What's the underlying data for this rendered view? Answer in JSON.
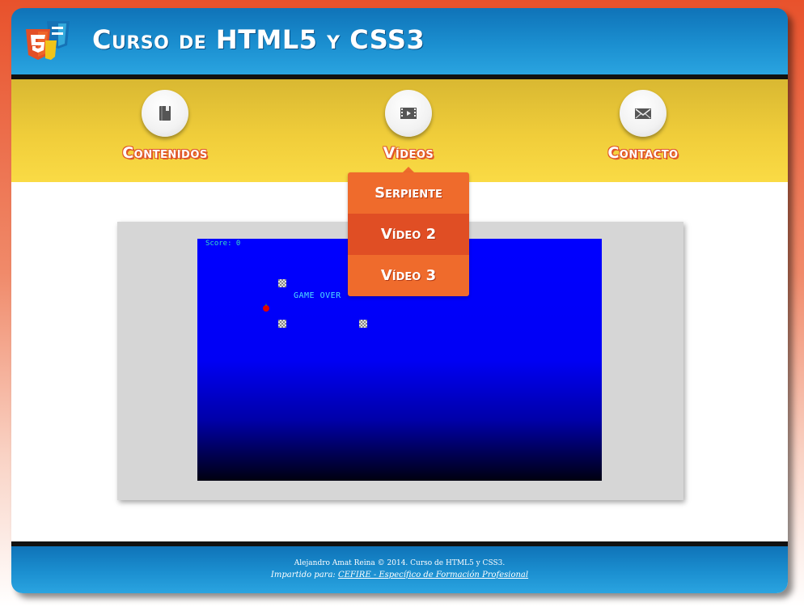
{
  "header": {
    "title": "Curso de HTML5 y CSS3"
  },
  "nav": {
    "items": [
      {
        "label": "Contenidos",
        "icon": "book-icon"
      },
      {
        "label": "Vídeos",
        "icon": "film-icon"
      },
      {
        "label": "Contacto",
        "icon": "envelope-icon"
      }
    ],
    "dropdown": [
      "Serpiente",
      "Vídeo 2",
      "Vídeo 3"
    ]
  },
  "game": {
    "score_text": "Score: 0",
    "gameover_text": "GAME OVER"
  },
  "footer": {
    "line1": "Alejandro Amat Reina © 2014. Curso de HTML5 y CSS3.",
    "line2_prefix": "Impartido para:",
    "line2_link": "CEFIRE - Específico de Formación Profesional"
  },
  "colors": {
    "header_blue": "#1b8fd0",
    "nav_yellow": "#f0cd3a",
    "dropdown_orange": "#ef6b2c",
    "dropdown_active": "#e04e24",
    "game_blue": "#0000ff"
  }
}
